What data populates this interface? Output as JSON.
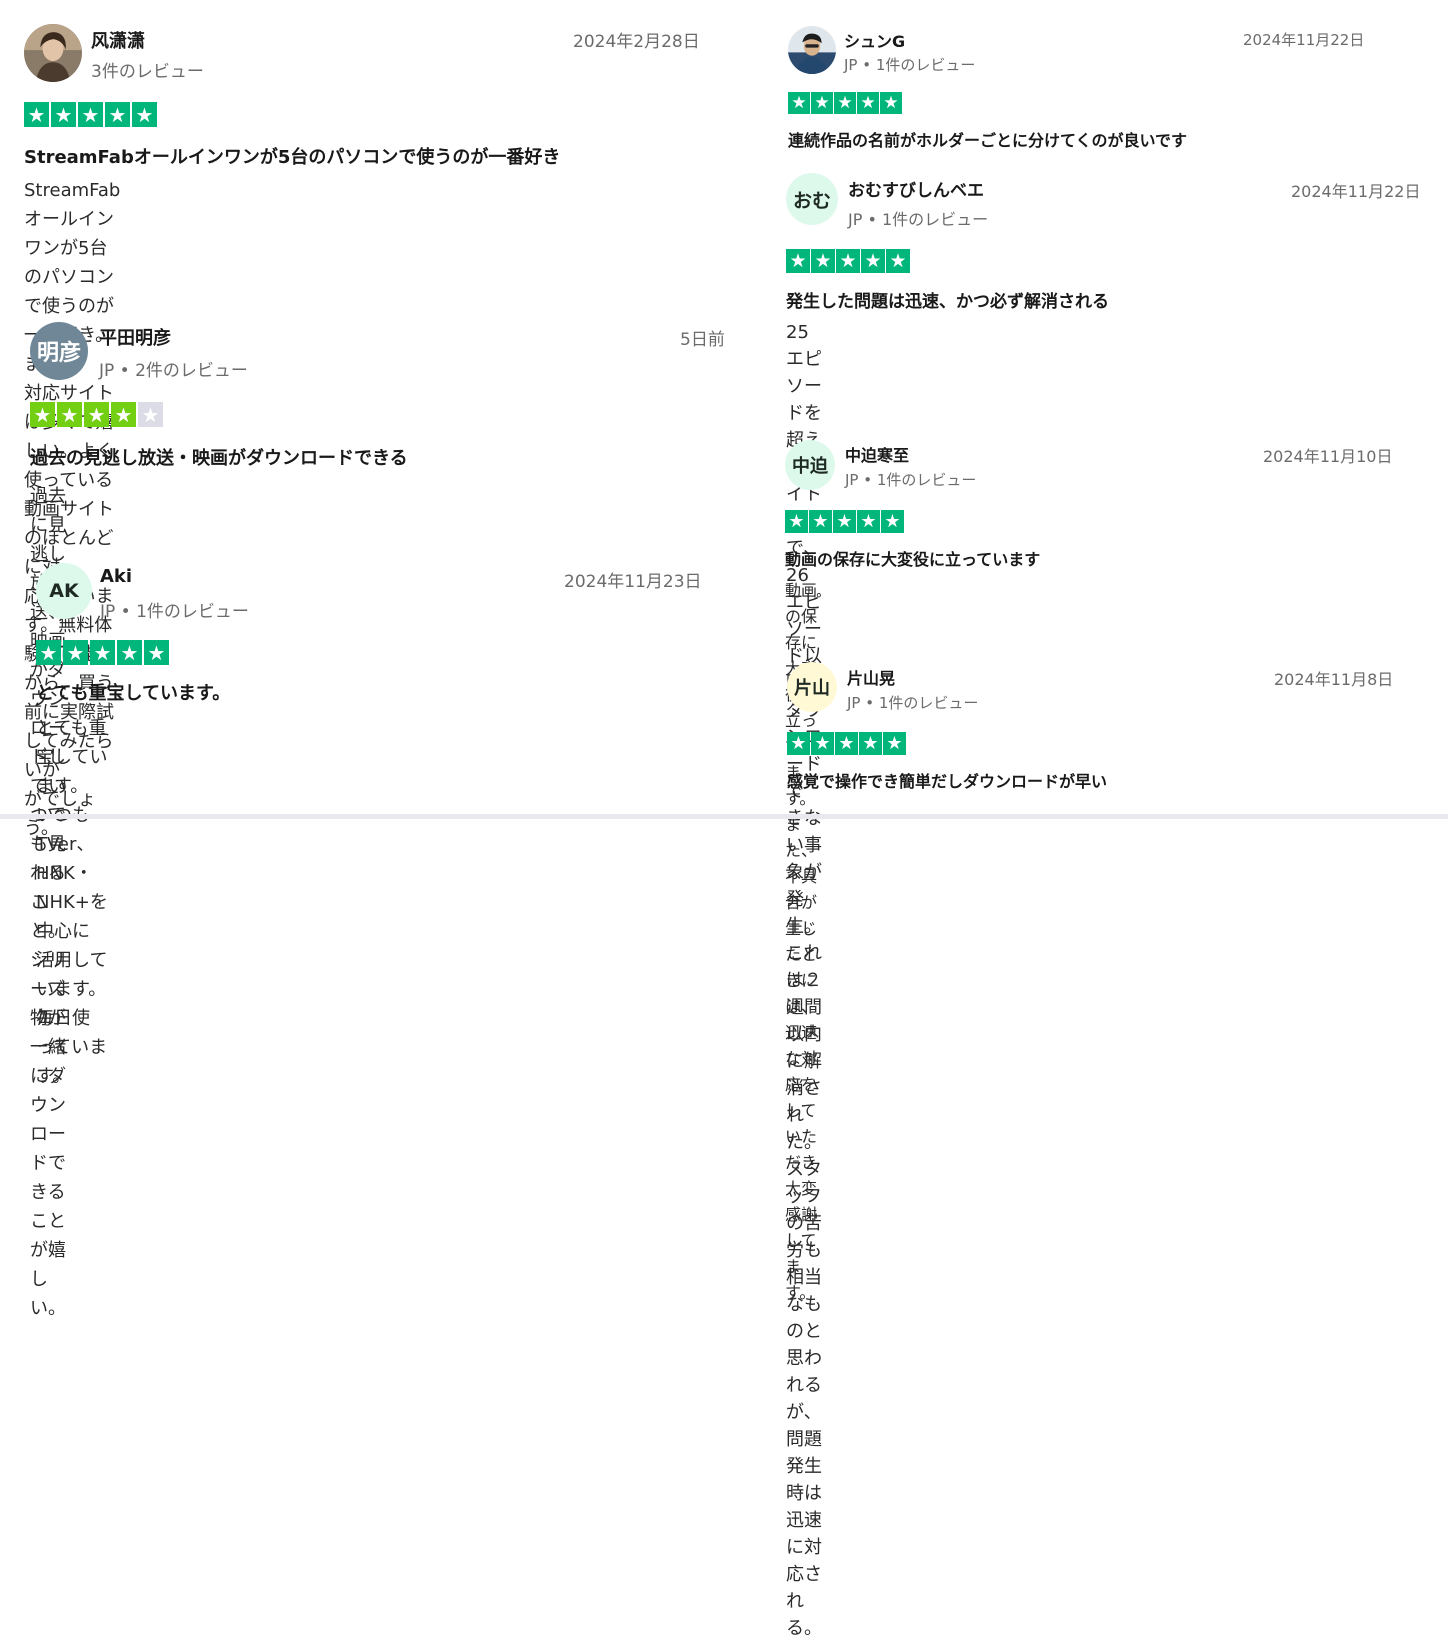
{
  "colors": {
    "star_green": "#00b67a",
    "star_lime": "#73cf11",
    "star_empty": "#dcdce6"
  },
  "reviews": [
    {
      "name": "风潇潇",
      "meta": "3件のレビュー",
      "date": "2024年2月28日",
      "avatar_type": "photo",
      "rating": 5,
      "title": "StreamFabオールインワンが5台のパソコンで使うのが一番好き",
      "body": "StreamFabオールインワンが5台のパソコンで使うのが一番好き。また、\n対応サイトは多くて嬉しい。よく使っている動画サイトのほとんどに対\n応しています。無料体験は可能だから、買う前に実際試してみたらいか\nがでしょう。"
    },
    {
      "name": "平田明彦",
      "meta": "JP • 2件のレビュー",
      "date": "5日前",
      "avatar_type": "initials",
      "initials": "明彦",
      "avatar_bg": "#6f8796",
      "avatar_fg": "#ffffff",
      "rating": 4,
      "title": "過去の見逃し放送・映画がダウンロードできる",
      "body": "過去に見逃し放送、映画がダウンロードしていつでも見れること。\nシリーズ物が一緒にダウンロードできることが嬉しい。"
    },
    {
      "name": "Aki",
      "meta": "JP • 1件のレビュー",
      "date": "2024年11月23日",
      "avatar_type": "initials",
      "initials": "AK",
      "avatar_bg": "#dcf9ec",
      "avatar_fg": "#1f2a24",
      "rating": 5,
      "title": "とても重宝しています。",
      "body": "とても重宝しています。\nいつもTVer、HNK・NHK+を中心に活用しています。\n毎日使っています。"
    },
    {
      "name": "シュンG",
      "meta": "JP • 1件のレビュー",
      "date": "2024年11月22日",
      "avatar_type": "photo",
      "rating": 5,
      "title": "連続作品の名前がホルダーごとに分けてくのが良いです",
      "body": ""
    },
    {
      "name": "おむすびしんベエ",
      "meta": "JP • 1件のレビュー",
      "date": "2024年11月22日",
      "avatar_type": "initials",
      "initials": "おむ",
      "avatar_bg": "#dcf9ec",
      "avatar_fg": "#1f2a24",
      "rating": 5,
      "title": "発生した問題は迅速、かつ必ず解消される",
      "body": "25エピソードを超えるタイトルで、26エピソード以降がダウンロードで\nきない事象が発生。これは２週間以内に解消された。\nスタッフの苦労も相当なものと思われるが、問題発生時は迅速に対応さ\nれる。"
    },
    {
      "name": "中迫寒至",
      "meta": "JP • 1件のレビュー",
      "date": "2024年11月10日",
      "avatar_type": "initials",
      "initials": "中迫",
      "avatar_bg": "#dcf9ec",
      "avatar_fg": "#1f2a24",
      "rating": 5,
      "title": "動画の保存に大変役に立っています",
      "body": "動画の保存に大変役に立っています。また、不具合が生じたときには、\n迅速な対応をしていただき大変感謝してます。"
    },
    {
      "name": "片山晃",
      "meta": "JP • 1件のレビュー",
      "date": "2024年11月8日",
      "avatar_type": "initials",
      "initials": "片山",
      "avatar_bg": "#fff9d6",
      "avatar_fg": "#1f2a24",
      "rating": 5,
      "title": "感覚で操作でき簡単だしダウンロードが早い",
      "body": ""
    }
  ]
}
